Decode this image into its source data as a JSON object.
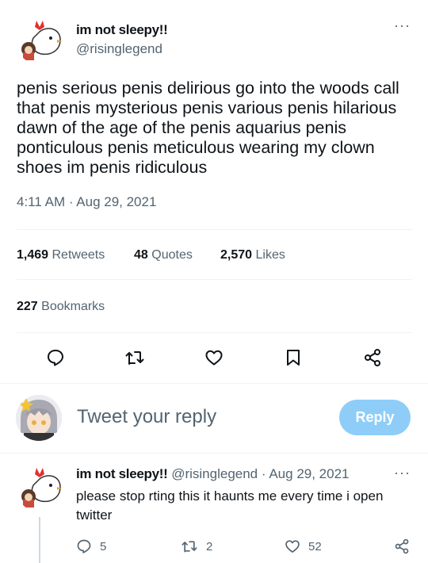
{
  "tweet": {
    "author_name": "im not sleepy!!",
    "author_handle": "@risinglegend",
    "more_label": "···",
    "text": "penis serious penis delirious go into the woods call that penis mysterious penis various penis hilarious dawn of the age of the penis aquarius penis ponticulous penis meticulous wearing my clown shoes im penis ridiculous",
    "timestamp": "4:11 AM · Aug 29, 2021"
  },
  "stats": {
    "retweets_count": "1,469",
    "retweets_label": "Retweets",
    "quotes_count": "48",
    "quotes_label": "Quotes",
    "likes_count": "2,570",
    "likes_label": "Likes",
    "bookmarks_count": "227",
    "bookmarks_label": "Bookmarks"
  },
  "actions": [
    "reply-icon",
    "retweet-icon",
    "like-icon",
    "bookmark-icon",
    "share-icon"
  ],
  "compose": {
    "placeholder": "Tweet your reply",
    "button_label": "Reply",
    "button_color": "#8ecdf8"
  },
  "reply": {
    "author_name": "im not sleepy!!",
    "author_handle": "@risinglegend",
    "date": "Aug 29, 2021",
    "more_label": "···",
    "text": "please stop rting this it haunts me every time i open twitter",
    "reply_count": "5",
    "retweet_count": "2",
    "like_count": "52"
  },
  "colors": {
    "text": "#0f1419",
    "secondary": "#536471",
    "divider": "#eff3f4"
  }
}
